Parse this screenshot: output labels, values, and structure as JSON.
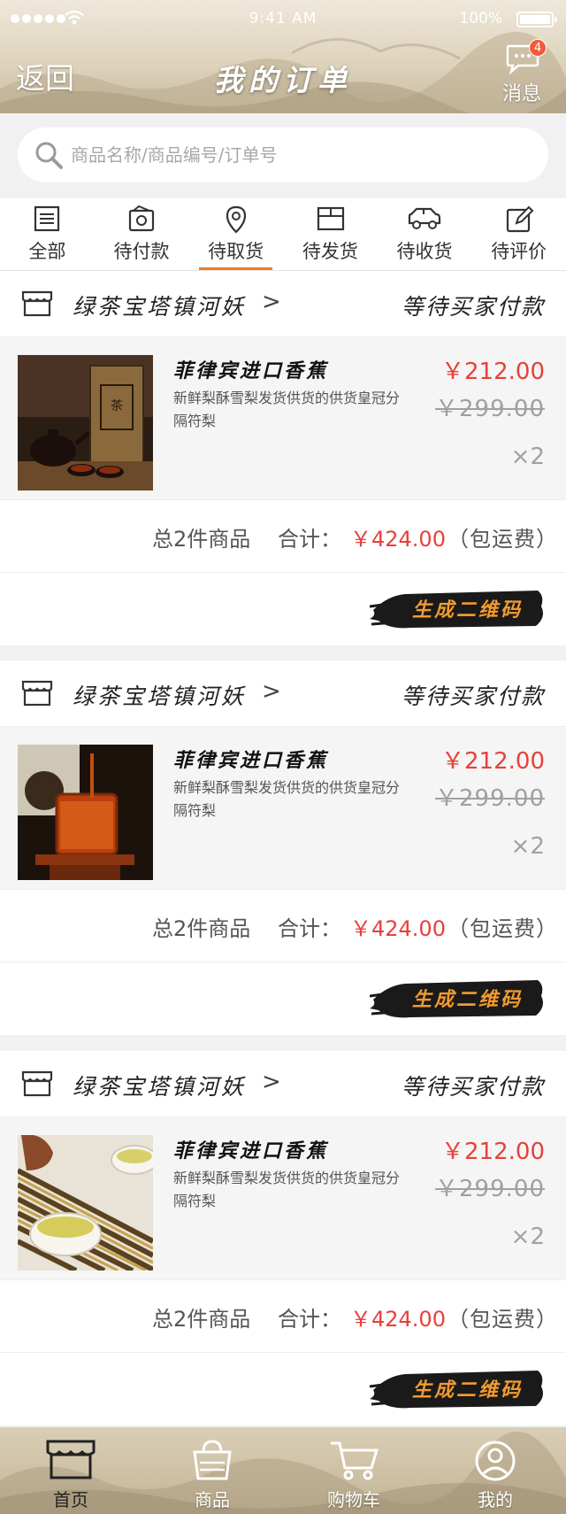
{
  "status_bar": {
    "time": "9:41 AM",
    "battery": "100%"
  },
  "header": {
    "back_label": "返回",
    "title": "我的订单",
    "messages_label": "消息",
    "messages_badge": "4"
  },
  "search": {
    "placeholder": "商品名称/商品编号/订单号"
  },
  "tabs": [
    {
      "label": "全部",
      "icon": "list-icon"
    },
    {
      "label": "待付款",
      "icon": "wallet-icon"
    },
    {
      "label": "待取货",
      "icon": "location-pin-icon",
      "active": true
    },
    {
      "label": "待发货",
      "icon": "box-icon"
    },
    {
      "label": "待收货",
      "icon": "truck-icon"
    },
    {
      "label": "待评价",
      "icon": "edit-icon"
    }
  ],
  "orders": [
    {
      "store": "绿茶宝塔镇河妖",
      "arrow": ">",
      "status": "等待买家付款",
      "product": {
        "name": "菲律宾进口香蕉",
        "desc": "新鲜梨酥雪梨发货供货的供货皇冠分隔符梨",
        "price": "￥212.00",
        "original_price": "￥299.00",
        "qty": "×2",
        "image": "tea-pot-and-tea-brick"
      },
      "summary": {
        "count": "总2件商品",
        "total_label": "合计：",
        "total": "￥424.00",
        "shipping": "（包运费）"
      },
      "action_label": "生成二维码"
    },
    {
      "store": "绿茶宝塔镇河妖",
      "arrow": ">",
      "status": "等待买家付款",
      "product": {
        "name": "菲律宾进口香蕉",
        "desc": "新鲜梨酥雪梨发货供货的供货皇冠分隔符梨",
        "price": "￥212.00",
        "original_price": "￥299.00",
        "qty": "×2",
        "image": "tea-pouring-into-glass"
      },
      "summary": {
        "count": "总2件商品",
        "total_label": "合计：",
        "total": "￥424.00",
        "shipping": "（包运费）"
      },
      "action_label": "生成二维码"
    },
    {
      "store": "绿茶宝塔镇河妖",
      "arrow": ">",
      "status": "等待买家付款",
      "product": {
        "name": "菲律宾进口香蕉",
        "desc": "新鲜梨酥雪梨发货供货的供货皇冠分隔符梨",
        "price": "￥212.00",
        "original_price": "￥299.00",
        "qty": "×2",
        "image": "green-tea-cups-on-bamboo"
      },
      "summary": {
        "count": "总2件商品",
        "total_label": "合计：",
        "total": "￥424.00",
        "shipping": "（包运费）"
      },
      "action_label": "生成二维码"
    }
  ],
  "bottom_nav": [
    {
      "label": "首页",
      "icon": "storefront-icon",
      "active": true
    },
    {
      "label": "商品",
      "icon": "shopping-bag-icon"
    },
    {
      "label": "购物车",
      "icon": "shopping-cart-icon"
    },
    {
      "label": "我的",
      "icon": "user-icon"
    }
  ],
  "colors": {
    "accent": "#f47c20",
    "price": "#e8403a",
    "header_bg": "#ded3bd"
  }
}
